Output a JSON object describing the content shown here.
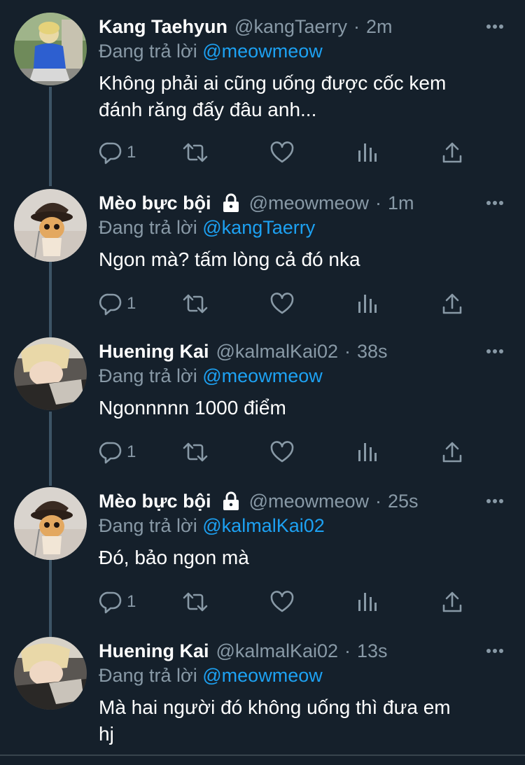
{
  "tweets": [
    {
      "name": "Kang Taehyun",
      "handle": "@kangTaerry",
      "time": "2m",
      "replying_prefix": "Đang trả lời ",
      "replying_to": "@meowmeow",
      "text_line1": "Không phải ai cũng uống được cốc kem",
      "text_line2": "đánh răng đấy đâu anh...",
      "reply_count": "1",
      "locked": false,
      "avatar": "blonde-boy-blue-jacket"
    },
    {
      "name": "Mèo bực bội",
      "handle": "@meowmeow",
      "time": "1m",
      "replying_prefix": "Đang trả lời ",
      "replying_to": "@kangTaerry",
      "text_line1": "Ngon mà? tấm lòng cả đó nka",
      "text_line2": "",
      "reply_count": "1",
      "locked": true,
      "avatar": "kitten-with-hat"
    },
    {
      "name": "Huening Kai",
      "handle": "@kalmalKai02",
      "time": "38s",
      "replying_prefix": "Đang trả lời ",
      "replying_to": "@meowmeow",
      "text_line1": "Ngonnnnn 1000 điểm",
      "text_line2": "",
      "reply_count": "1",
      "locked": false,
      "avatar": "blonde-boy-lying"
    },
    {
      "name": "Mèo bực bội",
      "handle": "@meowmeow",
      "time": "25s",
      "replying_prefix": "Đang trả lời ",
      "replying_to": "@kalmalKai02",
      "text_line1": "Đó, bảo ngon mà",
      "text_line2": "",
      "reply_count": "1",
      "locked": true,
      "avatar": "kitten-with-hat"
    },
    {
      "name": "Huening Kai",
      "handle": "@kalmalKai02",
      "time": "13s",
      "replying_prefix": "Đang trả lời ",
      "replying_to": "@meowmeow",
      "text_line1": "Mà hai người đó không uống thì đưa em",
      "text_line2": "hj",
      "reply_count": "",
      "locked": false,
      "avatar": "blonde-boy-lying"
    }
  ],
  "separator": "·",
  "colors": {
    "background": "#15202b",
    "secondary_text": "#8899a6",
    "accent": "#1da1f2",
    "thread_line": "#3d5466"
  },
  "icons": {
    "reply": "reply-icon",
    "retweet": "retweet-icon",
    "like": "like-icon",
    "analytics": "analytics-icon",
    "share": "share-icon",
    "more": "more-icon",
    "lock": "lock-icon"
  }
}
